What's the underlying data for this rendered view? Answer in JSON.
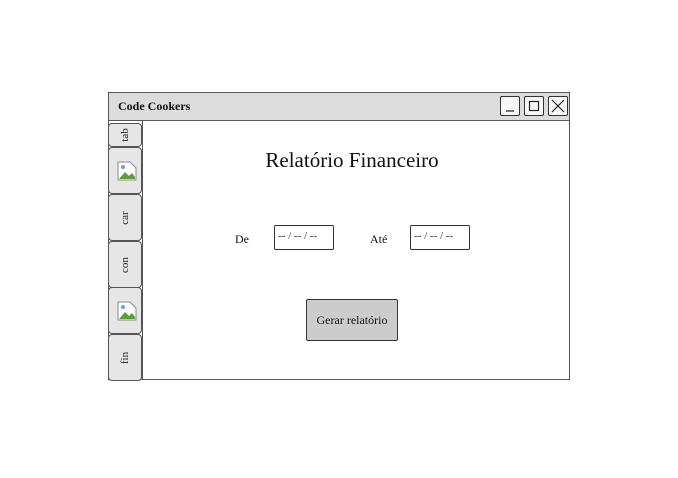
{
  "window": {
    "title": "Code Cookers",
    "controls": {
      "minimize_icon": "minimize-icon",
      "maximize_icon": "maximize-icon",
      "close_icon": "close-icon"
    }
  },
  "sidebar": {
    "items": [
      {
        "type": "text",
        "label": "tab"
      },
      {
        "type": "image",
        "icon": "broken-image-icon"
      },
      {
        "type": "text",
        "label": "car"
      },
      {
        "type": "text",
        "label": "con"
      },
      {
        "type": "image",
        "icon": "broken-image-icon"
      },
      {
        "type": "text",
        "label": "fin"
      }
    ]
  },
  "main": {
    "heading": "Relatório Financeiro",
    "from_label": "De",
    "from_value": "-- / -- / --",
    "to_label": "Até",
    "to_value": "-- / -- / --",
    "generate_button": "Gerar relatório"
  },
  "colors": {
    "titlebar": "#dcdcdc",
    "tab_background": "#e6e6e6",
    "button_background": "#cccccc",
    "border": "#555555"
  }
}
